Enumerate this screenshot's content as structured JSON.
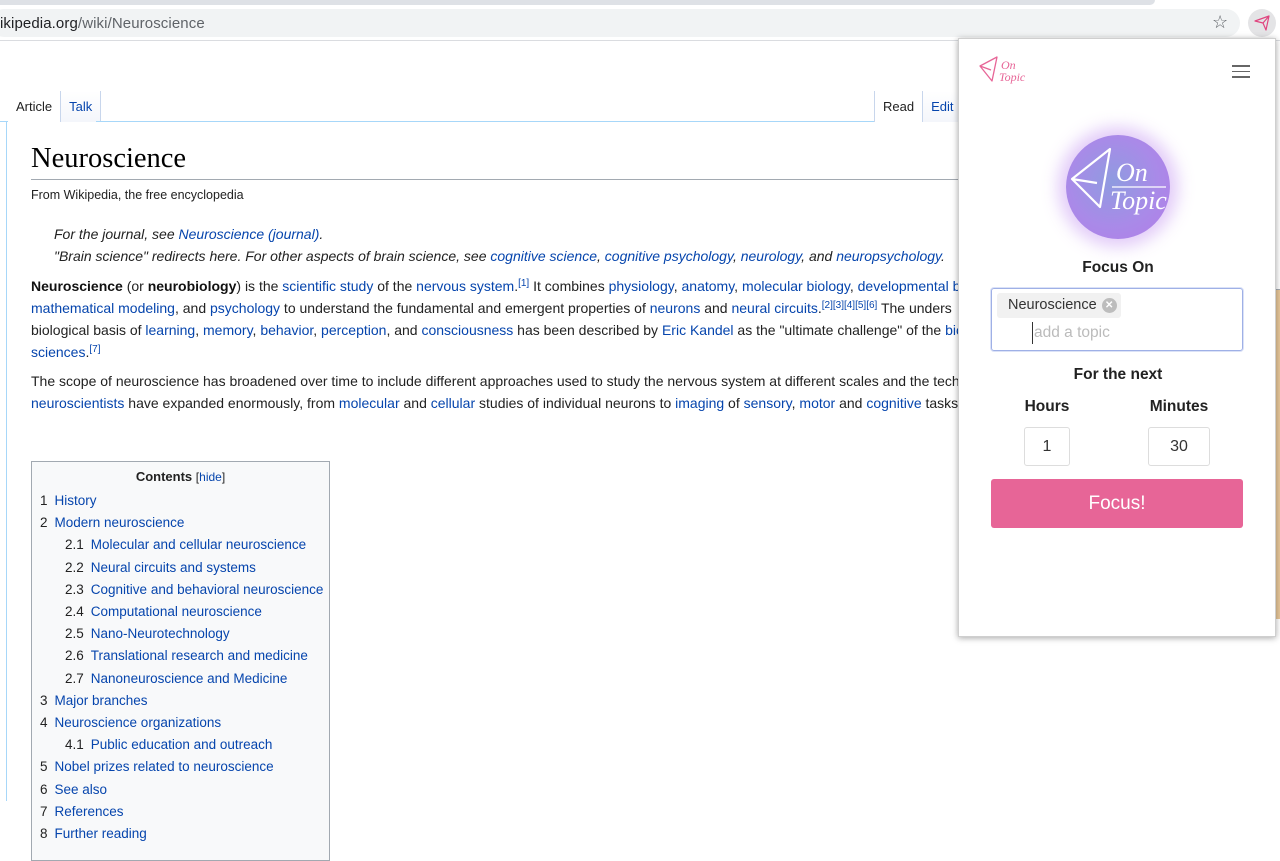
{
  "browser": {
    "url_host": "ikipedia.org",
    "url_path": "/wiki/Neuroscience",
    "bookmark_icon": "star-icon",
    "extension_icon": "paper-plane-icon"
  },
  "wiki": {
    "tabs_left": [
      "Article",
      "Talk"
    ],
    "tabs_right": [
      "Read",
      "Edit"
    ],
    "title": "Neuroscience",
    "tagline": "From Wikipedia, the free encyclopedia",
    "hatnote1": {
      "prefix": "For the journal, see ",
      "link": "Neuroscience (journal)",
      "suffix": "."
    },
    "hatnote2": {
      "prefix": "\"Brain science\" redirects here. For other aspects of brain science, see ",
      "links": [
        "cognitive science",
        "cognitive psychology",
        "neurology",
        "neuropsychology"
      ],
      "sep1": ", ",
      "sep2": ", ",
      "sep3": ", and ",
      "suffix": "."
    },
    "para1": {
      "l1": {
        "b1": "Neuroscience",
        "t1": " (or ",
        "b2": "neurobiology",
        "t2": ") is the ",
        "a1": "scientific study",
        "t3": " of the ",
        "a2": "nervous system",
        "t4": ".",
        "s1": "[1]",
        "t5": " It combines ",
        "a3": "physiology",
        "t6": ", ",
        "a4": "anatomy",
        "t7": ", ",
        "a5": "molecular biology",
        "t8": ", ",
        "a6": "developmental b"
      },
      "l2": {
        "a1": "mathematical modeling",
        "t1": ", and ",
        "a2": "psychology",
        "t2": " to understand the fundamental and emergent properties of ",
        "a3": "neurons",
        "t3": " and ",
        "a4": "neural circuits",
        "t4": ".",
        "s1": "[2][3][4][5][6]",
        "t5": " The unders"
      },
      "l3": {
        "t1": "biological basis of ",
        "a1": "learning",
        "t2": ", ",
        "a2": "memory",
        "t3": ", ",
        "a3": "behavior",
        "t4": ", ",
        "a4": "perception",
        "t5": ", and ",
        "a5": "consciousness",
        "t6": " has been described by ",
        "a6": "Eric Kandel",
        "t7": " as the \"ultimate challenge\" of the ",
        "a7": "bio"
      },
      "l4": {
        "a1": "sciences",
        "t1": ".",
        "s1": "[7]"
      }
    },
    "para2": {
      "l1": "The scope of neuroscience has broadened over time to include different approaches used to study the nervous system at different scales and the tech",
      "l2": {
        "a1": "neuroscientists",
        "t1": " have expanded enormously, from ",
        "a2": "molecular",
        "t2": " and ",
        "a3": "cellular",
        "t3": " studies of individual neurons to ",
        "a4": "imaging",
        "t4": " of ",
        "a5": "sensory",
        "t5": ", ",
        "a6": "motor",
        "t6": " and ",
        "a7": "cognitive",
        "t7": " tasks"
      }
    },
    "toc": {
      "title": "Contents",
      "hide_label": "hide",
      "items": [
        {
          "num": "1",
          "label": "History"
        },
        {
          "num": "2",
          "label": "Modern neuroscience"
        },
        {
          "num": "2.1",
          "label": "Molecular and cellular neuroscience"
        },
        {
          "num": "2.2",
          "label": "Neural circuits and systems"
        },
        {
          "num": "2.3",
          "label": "Cognitive and behavioral neuroscience"
        },
        {
          "num": "2.4",
          "label": "Computational neuroscience"
        },
        {
          "num": "2.5",
          "label": "Nano-Neurotechnology"
        },
        {
          "num": "2.6",
          "label": "Translational research and medicine"
        },
        {
          "num": "2.7",
          "label": "Nanoneuroscience and Medicine"
        },
        {
          "num": "3",
          "label": "Major branches"
        },
        {
          "num": "4",
          "label": "Neuroscience organizations"
        },
        {
          "num": "4.1",
          "label": "Public education and outreach"
        },
        {
          "num": "5",
          "label": "Nobel prizes related to neuroscience"
        },
        {
          "num": "6",
          "label": "See also"
        },
        {
          "num": "7",
          "label": "References"
        },
        {
          "num": "8",
          "label": "Further reading"
        }
      ]
    }
  },
  "popup": {
    "logo_line1": "On",
    "logo_line2": "Topic",
    "menu_icon": "hamburger-menu-icon",
    "focus_on_label": "Focus On",
    "topic_chip": "Neuroscience",
    "topic_placeholder": "add a topic",
    "for_next_label": "For the next",
    "hours_label": "Hours",
    "hours_value": "1",
    "minutes_label": "Minutes",
    "minutes_value": "30",
    "focus_button": "Focus!",
    "colors": {
      "accent_pink": "#e76597",
      "logo_purple": "#a98ae8"
    }
  }
}
